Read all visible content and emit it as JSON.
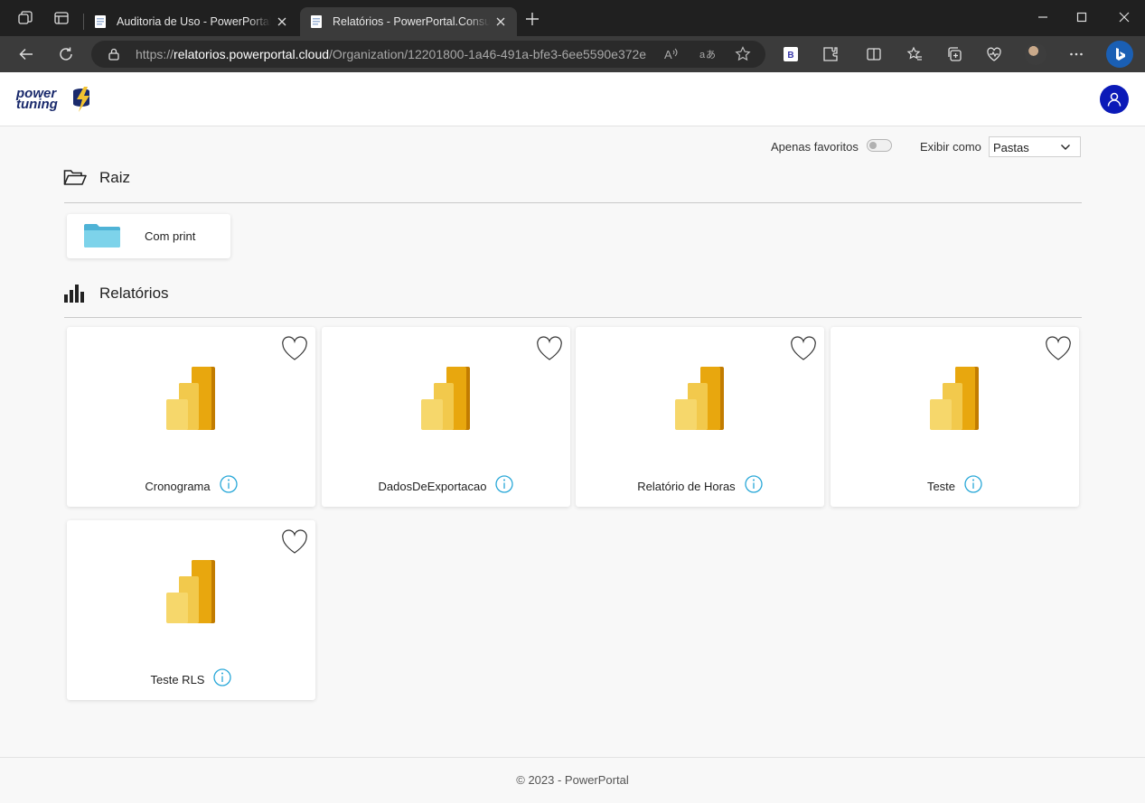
{
  "browser": {
    "tabs": [
      {
        "title": "Auditoria de Uso - PowerPortal.M",
        "active": false
      },
      {
        "title": "Relatórios - PowerPortal.Consum",
        "active": true
      }
    ],
    "url_prefix": "https://",
    "url_host": "relatorios.powerportal.cloud",
    "url_path": "/Organization/12201800-1a46-491a-bfe3-6ee5590e372e",
    "extension_badge": "B"
  },
  "header": {
    "logo_text_top": "power",
    "logo_text_bottom": "tuning"
  },
  "controls": {
    "favorites_label": "Apenas favoritos",
    "favorites_on": false,
    "view_as_label": "Exibir como",
    "view_as_value": "Pastas"
  },
  "folders_section": {
    "title": "Raiz",
    "items": [
      {
        "label": "Com print"
      }
    ]
  },
  "reports_section": {
    "title": "Relatórios",
    "items": [
      {
        "label": "Cronograma"
      },
      {
        "label": "DadosDeExportacao"
      },
      {
        "label": "Relatório de Horas"
      },
      {
        "label": "Teste"
      },
      {
        "label": "Teste RLS"
      }
    ]
  },
  "footer": {
    "text": "© 2023 - PowerPortal"
  },
  "colors": {
    "accent_user": "#0b1ab8",
    "info_icon": "#29a8d8",
    "folder": "#6fc7e0",
    "pbi_dark": "#c27c00",
    "pbi_mid": "#e8a70e",
    "pbi_light": "#f2c94c"
  }
}
